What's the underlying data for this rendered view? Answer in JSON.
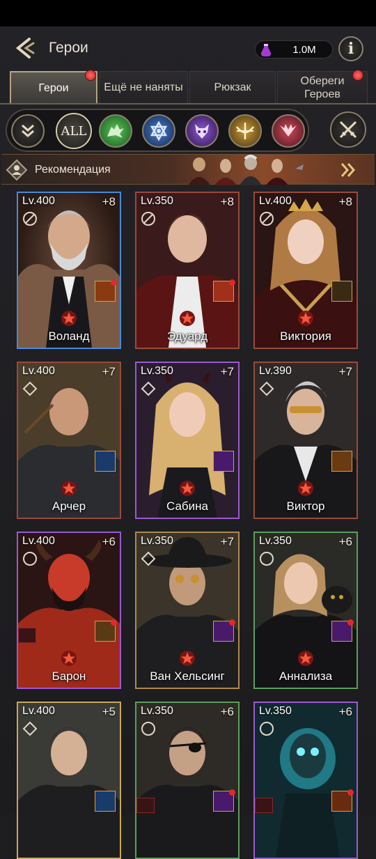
{
  "header": {
    "title": "Герои",
    "currency_value": "1.0M",
    "info_label": "i"
  },
  "tabs": [
    {
      "label": "Герои",
      "active": true,
      "badge": true
    },
    {
      "label": "Ещё не наняты",
      "active": false,
      "badge": false
    },
    {
      "label": "Рюкзак",
      "active": false,
      "badge": false
    },
    {
      "label": "Обереги Героев",
      "active": false,
      "badge": true
    }
  ],
  "filters": {
    "all_label": "ALL",
    "items": [
      "collapse-icon",
      "all",
      "wolf-icon",
      "star-of-david-icon",
      "demon-mask-icon",
      "crossbow-icon",
      "vampire-wings-icon"
    ],
    "colors": {
      "wolf": "#2f8a32",
      "star": "#2a4f8a",
      "demon": "#5e2f8e",
      "crossbow": "#8a6a1e",
      "vampire": "#8a2230"
    }
  },
  "recommendation": {
    "label": "Рекомендация"
  },
  "heroes": [
    {
      "level": "Lv.400",
      "plus": "+8",
      "name": "Воланд",
      "frame": "#4a8ad8"
    },
    {
      "level": "Lv.350",
      "plus": "+8",
      "name": "Эдуард",
      "frame": "#9a4a3a"
    },
    {
      "level": "Lv.400",
      "plus": "+8",
      "name": "Виктория",
      "frame": "#9a4a3a"
    },
    {
      "level": "Lv.400",
      "plus": "+7",
      "name": "Арчер",
      "frame": "#9a4a3a"
    },
    {
      "level": "Lv.350",
      "plus": "+7",
      "name": "Сабина",
      "frame": "#9a5ad0"
    },
    {
      "level": "Lv.390",
      "plus": "+7",
      "name": "Виктор",
      "frame": "#9a4a3a"
    },
    {
      "level": "Lv.400",
      "plus": "+6",
      "name": "Барон",
      "frame": "#9a5ad0"
    },
    {
      "level": "Lv.350",
      "plus": "+7",
      "name": "Ван Хельсинг",
      "frame": "#b08a4a"
    },
    {
      "level": "Lv.350",
      "plus": "+6",
      "name": "Аннализа",
      "frame": "#5aa05a"
    },
    {
      "level": "Lv.400",
      "plus": "+5",
      "name": "",
      "frame": "#c9a85a"
    },
    {
      "level": "Lv.350",
      "plus": "+6",
      "name": "",
      "frame": "#5aa05a"
    },
    {
      "level": "Lv.350",
      "plus": "+6",
      "name": "",
      "frame": "#9a5ad0"
    }
  ]
}
